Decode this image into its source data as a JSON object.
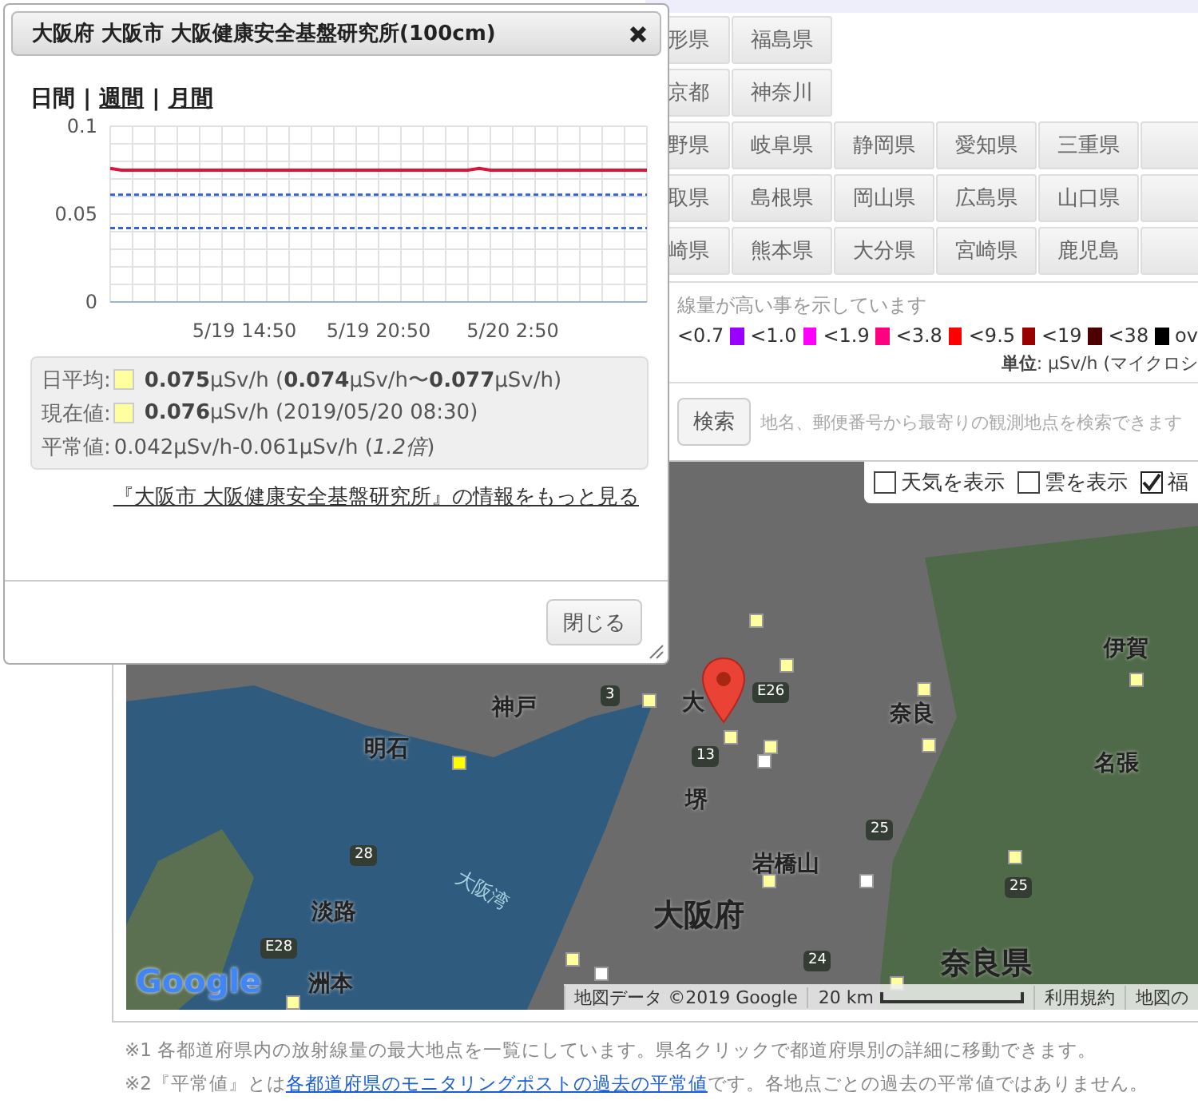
{
  "prefecture_rows": [
    {
      "buttons": [
        "形県",
        "福島県"
      ]
    },
    {
      "buttons": [
        "京都",
        "神奈川"
      ]
    },
    {
      "buttons": [
        "野県",
        "岐阜県",
        "静岡県",
        "愛知県",
        "三重県"
      ],
      "continues": true
    },
    {
      "buttons": [
        "取県",
        "島根県",
        "岡山県",
        "広島県",
        "山口県"
      ],
      "continues": true
    },
    {
      "buttons": [
        "崎県",
        "熊本県",
        "大分県",
        "宮崎県",
        "鹿児島"
      ],
      "continues": true
    }
  ],
  "legend": {
    "note": "線量が高い事を示しています",
    "items": [
      {
        "label": "<0.7",
        "color": "#9900ff"
      },
      {
        "label": "<1.0",
        "color": "#ff00ff"
      },
      {
        "label": "<1.9",
        "color": "#ff0080"
      },
      {
        "label": "<3.8",
        "color": "#ff0000"
      },
      {
        "label": "<9.5",
        "color": "#990000"
      },
      {
        "label": "<19",
        "color": "#4d0000"
      },
      {
        "label": "<38",
        "color": "#000000"
      },
      {
        "label": "ov"
      }
    ],
    "unit": "**単位**: μSv/h (マイクロシ"
  },
  "search": {
    "button": "検索",
    "placeholder": "地名、郵便番号から最寄りの観測地点を検索できます"
  },
  "map": {
    "layers": [
      {
        "label": "天気を表示",
        "checked": false
      },
      {
        "label": "雲を表示",
        "checked": false
      },
      {
        "label": "福",
        "checked": true
      }
    ],
    "labels": [
      {
        "text": "神戸",
        "kind": "city"
      },
      {
        "text": "明石",
        "kind": "city"
      },
      {
        "text": "大",
        "kind": "city"
      },
      {
        "text": "奈良",
        "kind": "city"
      },
      {
        "text": "伊賀",
        "kind": "city"
      },
      {
        "text": "名張",
        "kind": "city"
      },
      {
        "text": "堺",
        "kind": "city"
      },
      {
        "text": "岩橋山",
        "kind": "city"
      },
      {
        "text": "大阪湾",
        "kind": "water"
      },
      {
        "text": "淡路",
        "kind": "city"
      },
      {
        "text": "大阪府",
        "kind": "region"
      },
      {
        "text": "奈良県",
        "kind": "region"
      },
      {
        "text": "洲本",
        "kind": "city"
      },
      {
        "text": "3",
        "kind": "road"
      },
      {
        "text": "E26",
        "kind": "road"
      },
      {
        "text": "13",
        "kind": "road"
      },
      {
        "text": "25",
        "kind": "road"
      },
      {
        "text": "25",
        "kind": "road"
      },
      {
        "text": "24",
        "kind": "road"
      },
      {
        "text": "28",
        "kind": "road"
      },
      {
        "text": "E28",
        "kind": "road"
      }
    ],
    "markers": [
      {
        "color": "#ffffa0"
      },
      {
        "color": "#ffffa0"
      },
      {
        "color": "#ffffa0"
      },
      {
        "color": "#ffffa0"
      },
      {
        "color": "#ffffa0"
      },
      {
        "color": "#ffffa0"
      },
      {
        "color": "#ffffa0"
      },
      {
        "color": "#ffffa0"
      },
      {
        "color": "#ffff00"
      },
      {
        "color": "#ffffa0"
      },
      {
        "color": "#ffffa0"
      },
      {
        "color": "#ffffa0"
      },
      {
        "color": "#ffffa0"
      },
      {
        "color": "#ffffa0"
      },
      {
        "color": "#ffffff"
      },
      {
        "color": "#ffffff"
      },
      {
        "color": "#ffffff"
      }
    ],
    "logo": "Google",
    "attribution": "地図データ ©2019 Google",
    "scale": "20 km",
    "links": [
      "利用規約",
      "地図の"
    ]
  },
  "notes": [
    {
      "prefix": "※1 各都道府県内の放射線量の最大地点を一覧にしています。県名クリックで都道府県別の詳細に移動できます。"
    },
    {
      "prefix": "※2『平常値』とは",
      "link": "各都道府県のモニタリングポストの過去の平常値",
      "suffix": "です。各地点ごとの過去の平常値ではありません。"
    }
  ],
  "dialog": {
    "title": "大阪府 大阪市 大阪健康安全基盤研究所(100cm)",
    "tabs": [
      {
        "label": "日間",
        "selected": true
      },
      {
        "label": "週間",
        "selected": false
      },
      {
        "label": "月間",
        "selected": false
      }
    ],
    "separator": "|",
    "chart_data": {
      "type": "line",
      "categories": [
        null,
        null,
        null,
        null,
        null,
        null,
        null,
        null,
        null,
        null,
        null,
        null,
        "5/19 14:50",
        null,
        null,
        null,
        null,
        null,
        null,
        null,
        null,
        null,
        null,
        null,
        "5/19 20:50",
        null,
        null,
        null,
        null,
        null,
        null,
        null,
        null,
        null,
        null,
        null,
        "5/20 2:50",
        null,
        null,
        null,
        null,
        null,
        null,
        null,
        null,
        null,
        null,
        null,
        null
      ],
      "ylim": [
        0,
        0.1
      ],
      "grid": true,
      "yticks": [
        {
          "value": 0,
          "label": "0"
        },
        {
          "value": 0.05,
          "label": "0.05"
        },
        {
          "value": 0.1,
          "label": "0.1"
        }
      ],
      "series": [
        {
          "color": "#dc143c",
          "line_style": "solid",
          "values": [
            0.076,
            0.075,
            0.075,
            0.075,
            0.075,
            0.075,
            0.075,
            0.075,
            0.075,
            0.075,
            0.075,
            0.075,
            0.075,
            0.075,
            0.075,
            0.075,
            0.075,
            0.075,
            0.075,
            0.075,
            0.075,
            0.075,
            0.075,
            0.075,
            0.075,
            0.075,
            0.075,
            0.075,
            0.075,
            0.075,
            0.075,
            0.075,
            0.075,
            0.076,
            0.075,
            0.075,
            0.075,
            0.075,
            0.075,
            0.075,
            0.075,
            0.075,
            0.075,
            0.075,
            0.075,
            0.075,
            0.075,
            0.075,
            0.075
          ]
        },
        {
          "color": "#3366cc",
          "line_style": "dashed",
          "values": [
            0.061,
            0.061,
            0.061,
            0.061,
            0.061,
            0.061,
            0.061,
            0.061,
            0.061,
            0.061,
            0.061,
            0.061,
            0.061,
            0.061,
            0.061,
            0.061,
            0.061,
            0.061,
            0.061,
            0.061,
            0.061,
            0.061,
            0.061,
            0.061,
            0.061,
            0.061,
            0.061,
            0.061,
            0.061,
            0.061,
            0.061,
            0.061,
            0.061,
            0.061,
            0.061,
            0.061,
            0.061,
            0.061,
            0.061,
            0.061,
            0.061,
            0.061,
            0.061,
            0.061,
            0.061,
            0.061,
            0.061,
            0.061,
            0.061
          ]
        },
        {
          "color": "#3366cc",
          "line_style": "dashed",
          "values": [
            0.042,
            0.042,
            0.042,
            0.042,
            0.042,
            0.042,
            0.042,
            0.042,
            0.042,
            0.042,
            0.042,
            0.042,
            0.042,
            0.042,
            0.042,
            0.042,
            0.042,
            0.042,
            0.042,
            0.042,
            0.042,
            0.042,
            0.042,
            0.042,
            0.042,
            0.042,
            0.042,
            0.042,
            0.042,
            0.042,
            0.042,
            0.042,
            0.042,
            0.042,
            0.042,
            0.042,
            0.042,
            0.042,
            0.042,
            0.042,
            0.042,
            0.042,
            0.042,
            0.042,
            0.042,
            0.042,
            0.042,
            0.042,
            0.042
          ]
        }
      ]
    },
    "stats": [
      {
        "label": "日平均:",
        "color": "#ffffa0",
        "text": "**0.075**μSv/h (**0.074**μSv/h〜**0.077**μSv/h)"
      },
      {
        "label": "現在値:",
        "color": "#ffffa0",
        "text": "**0.076**μSv/h (2019/05/20 08:30)"
      },
      {
        "label": "平常値:",
        "text": "0.042μSv/h-0.061μSv/h (*1.2倍*)"
      }
    ],
    "more_link": "『大阪市 大阪健康安全基盤研究所』の情報をもっと見る",
    "close_button": "閉じる"
  }
}
